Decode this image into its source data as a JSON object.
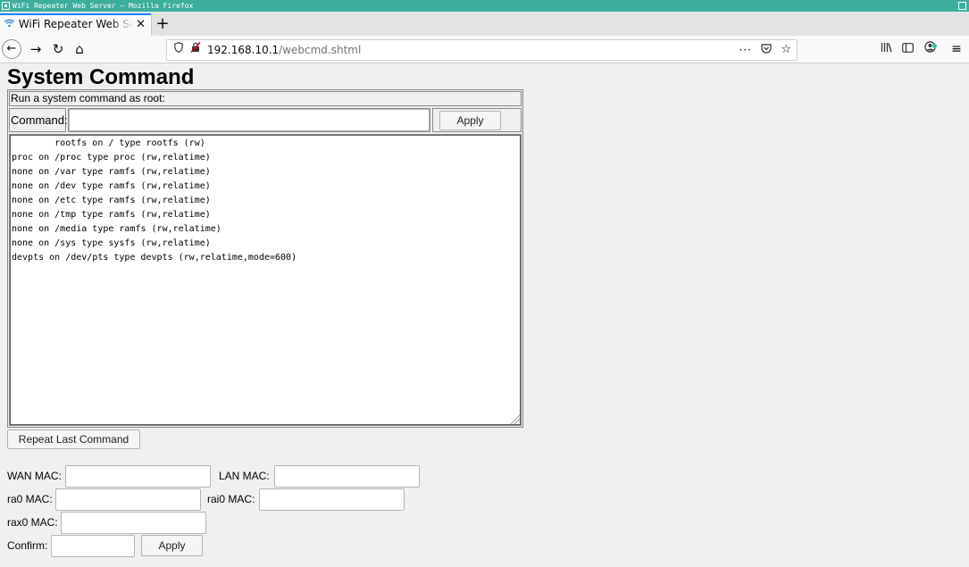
{
  "window": {
    "title": "WiFi Repeater Web Server — Mozilla Firefox"
  },
  "tabs": [
    {
      "label": "WiFi Repeater Web Server",
      "close": "✕"
    }
  ],
  "newtab": "+",
  "nav": {
    "back": "←",
    "forward": "→",
    "reload": "↻",
    "home": "⌂"
  },
  "urlbar": {
    "host": "192.168.10.1",
    "path": "/webcmd.shtml",
    "more": "···",
    "shield_icon": "shield-icon",
    "lock_icon": "insecure-lock-icon"
  },
  "page": {
    "title": "System Command",
    "caption": "Run a system command as root:",
    "command_label": "Command:",
    "command_value": "",
    "apply_label": "Apply",
    "output": "        rootfs on / type rootfs (rw)\nproc on /proc type proc (rw,relatime)\nnone on /var type ramfs (rw,relatime)\nnone on /dev type ramfs (rw,relatime)\nnone on /etc type ramfs (rw,relatime)\nnone on /tmp type ramfs (rw,relatime)\nnone on /media type ramfs (rw,relatime)\nnone on /sys type sysfs (rw,relatime)\ndevpts on /dev/pts type devpts (rw,relatime,mode=600)",
    "repeat_label": "Repeat Last Command",
    "wan_mac_label": "WAN MAC:",
    "lan_mac_label": "LAN MAC:",
    "ra0_mac_label": "ra0 MAC:",
    "rai0_mac_label": "rai0 MAC:",
    "rax0_mac_label": "rax0 MAC:",
    "confirm_label": "Confirm:",
    "confirm_apply_label": "Apply"
  },
  "colors": {
    "titlebar": "#3cae9c",
    "tab_accent": "#0a84ff",
    "page_bg": "#f0f0f0"
  }
}
